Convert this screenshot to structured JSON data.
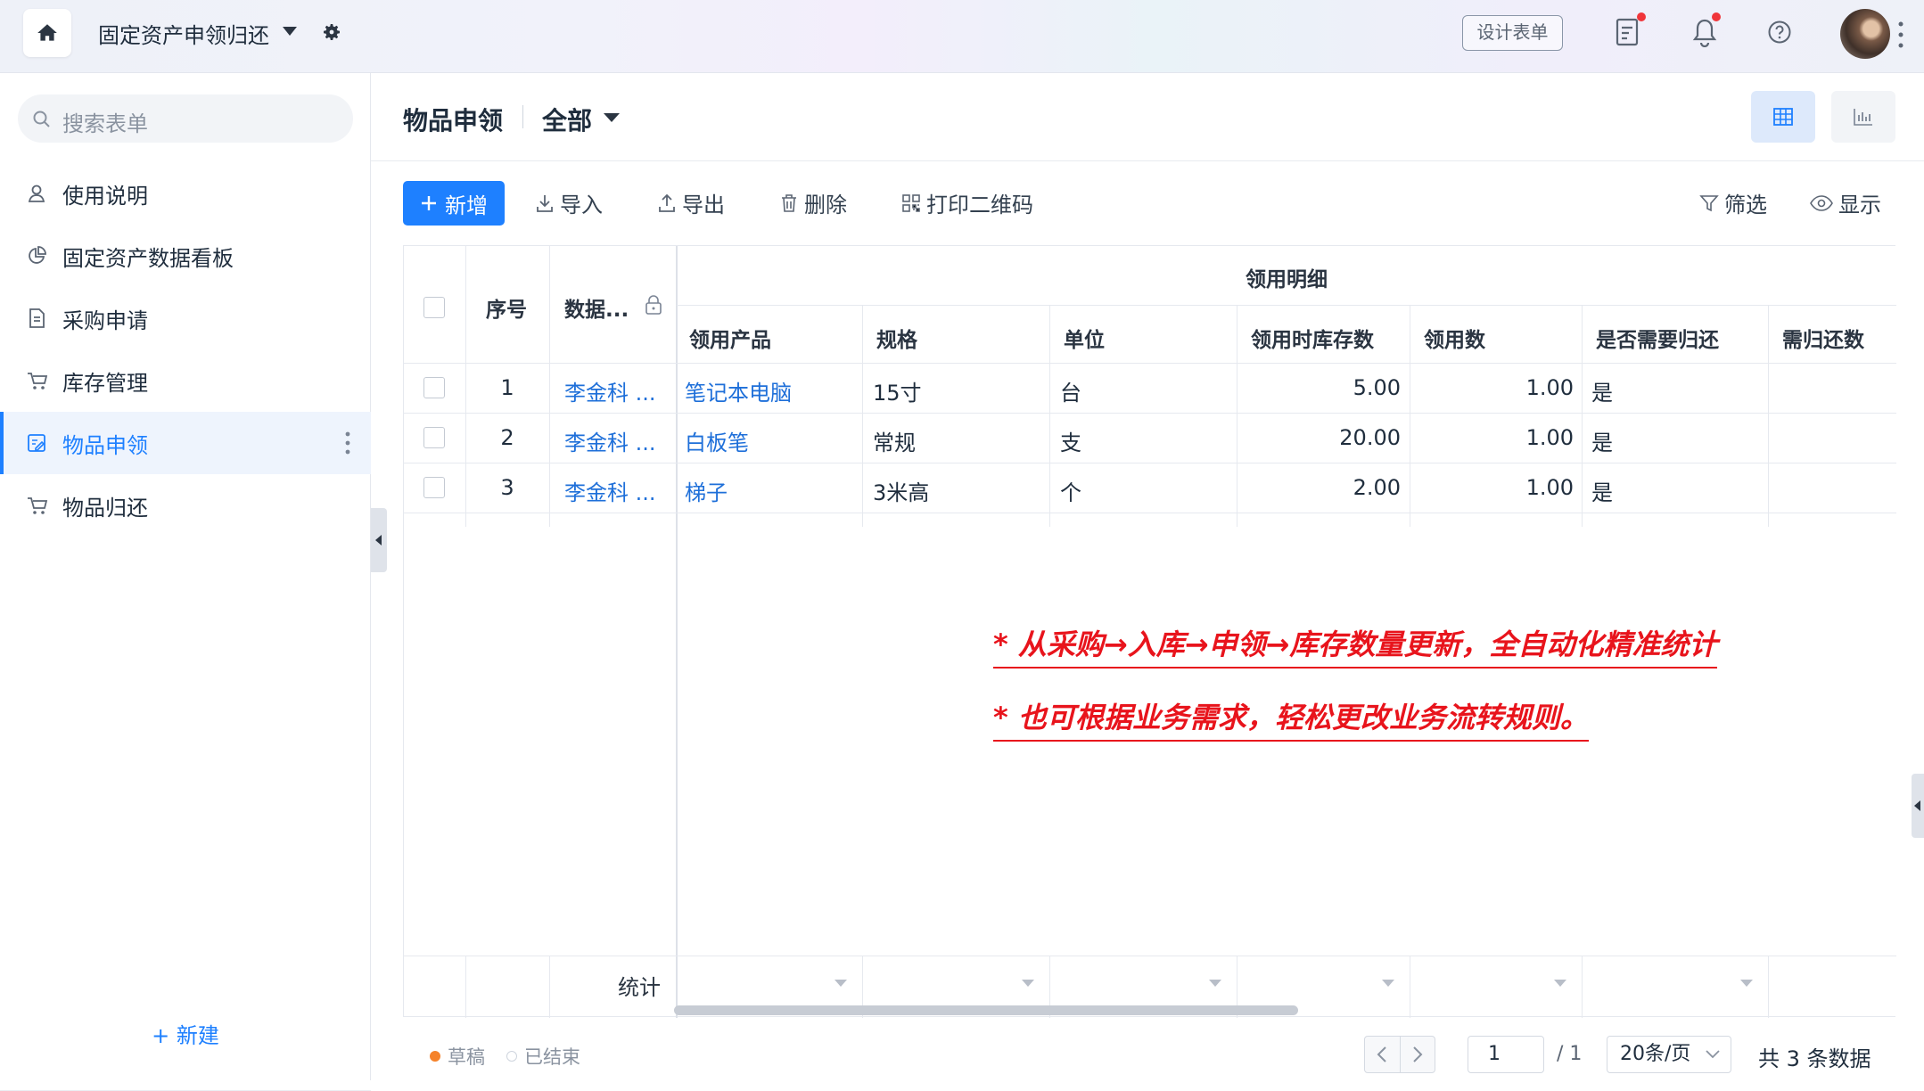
{
  "topbar": {
    "app_title": "固定资产申领归还",
    "design_form_label": "设计表单"
  },
  "sidebar": {
    "search_placeholder": "搜索表单",
    "items": [
      {
        "label": "使用说明",
        "icon": "user-guide-icon"
      },
      {
        "label": "固定资产数据看板",
        "icon": "pie-chart-icon"
      },
      {
        "label": "采购申请",
        "icon": "document-icon"
      },
      {
        "label": "库存管理",
        "icon": "cart-icon"
      },
      {
        "label": "物品申领",
        "icon": "form-edit-icon",
        "active": true
      },
      {
        "label": "物品归还",
        "icon": "cart-icon"
      }
    ],
    "new_label": "+ 新建"
  },
  "header": {
    "title": "物品申领",
    "view_name": "全部"
  },
  "toolbar": {
    "add": "新增",
    "import": "导入",
    "export": "导出",
    "delete": "删除",
    "print_qr": "打印二维码",
    "filter": "筛选",
    "display": "显示"
  },
  "table": {
    "group_header": "领用明细",
    "fixed_headers": {
      "index": "序号",
      "data": "数据..."
    },
    "detail_headers": [
      "领用产品",
      "规格",
      "单位",
      "领用时库存数",
      "领用数",
      "是否需要归还",
      "需归还数"
    ],
    "rows": [
      {
        "index": "1",
        "applicant": "李金科 ...",
        "product": "笔记本电脑",
        "spec": "15寸",
        "unit": "台",
        "stock": "5.00",
        "qty": "1.00",
        "need_return": "是",
        "return_qty": ""
      },
      {
        "index": "2",
        "applicant": "李金科 ...",
        "product": "白板笔",
        "spec": "常规",
        "unit": "支",
        "stock": "20.00",
        "qty": "1.00",
        "need_return": "是",
        "return_qty": ""
      },
      {
        "index": "3",
        "applicant": "李金科 ...",
        "product": "梯子",
        "spec": "3米高",
        "unit": "个",
        "stock": "2.00",
        "qty": "1.00",
        "need_return": "是",
        "return_qty": ""
      }
    ],
    "footer_label": "统计"
  },
  "notes": [
    "* 从采购→入库→申领→库存数量更新，全自动化精准统计",
    "* 也可根据业务需求，轻松更改业务流转规则。"
  ],
  "footer": {
    "status_draft": "草稿",
    "status_done": "已结束",
    "draft_color": "#f5822a",
    "page_input": "1",
    "page_total": "/ 1",
    "page_size": "20条/页",
    "total_count": "共 3 条数据"
  },
  "colors": {
    "accent": "#1e80ff",
    "note_red": "#e8141c"
  }
}
